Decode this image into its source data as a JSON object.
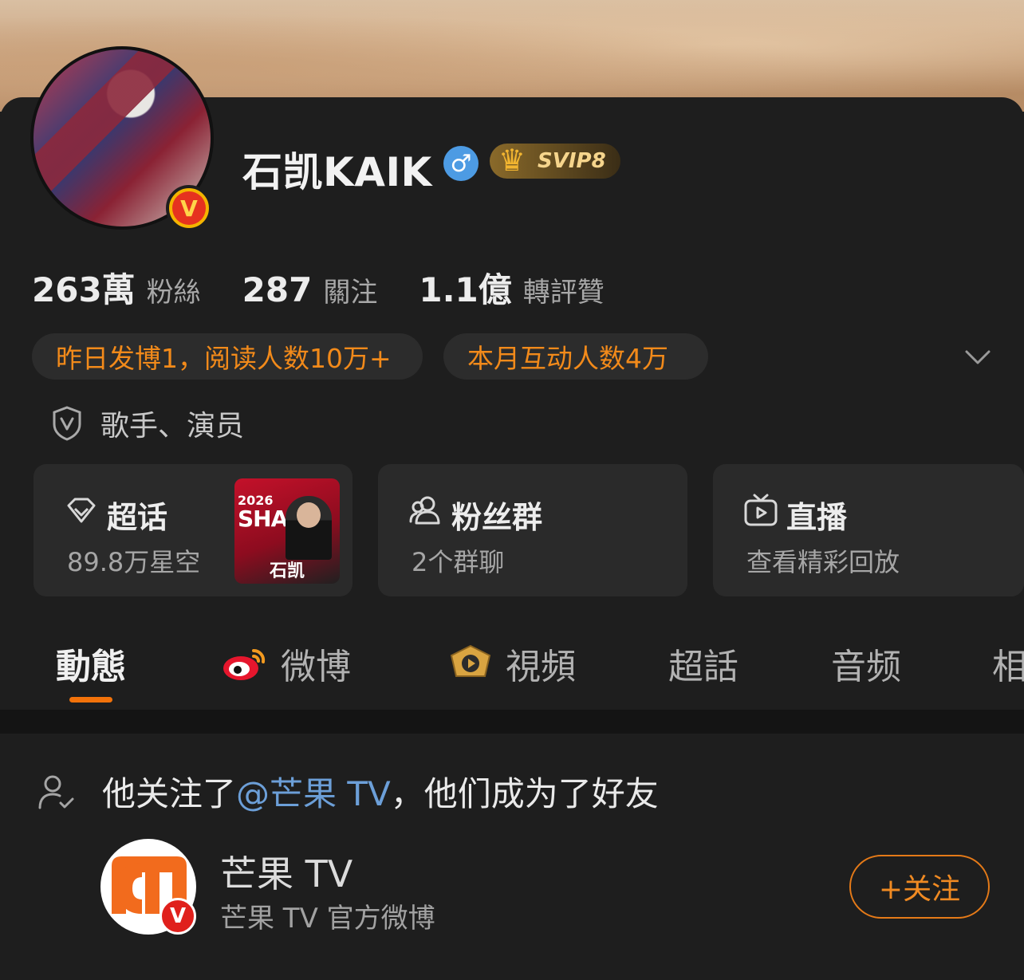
{
  "profile": {
    "name": "石凯KAIK",
    "gender_symbol": "♂",
    "vip_label": "SVIP8",
    "verified_symbol": "V"
  },
  "stats": [
    {
      "value": "263萬",
      "label": "粉絲"
    },
    {
      "value": "287",
      "label": "關注"
    },
    {
      "value": "1.1億",
      "label": "轉評贊"
    }
  ],
  "highlights": {
    "yesterday": "昨日发博1，阅读人数10万+",
    "month": "本月互动人数4万"
  },
  "tags": "歌手、演员",
  "features": [
    {
      "title": "超话",
      "sub": "89.8万星空",
      "icon": "diamond-icon"
    },
    {
      "title": "粉丝群",
      "sub": "2个群聊",
      "icon": "group-icon"
    },
    {
      "title": "直播",
      "sub": "查看精彩回放",
      "icon": "tv-icon"
    }
  ],
  "poster": {
    "year": "2026",
    "big": "SHAI",
    "name": "石凯"
  },
  "tabs": [
    {
      "label": "動態",
      "active": true
    },
    {
      "label": "微博"
    },
    {
      "label": "視頻"
    },
    {
      "label": "超話"
    },
    {
      "label": "音频"
    },
    {
      "label": "相"
    }
  ],
  "activity": {
    "prefix": "他关注了",
    "mention": "@芒果 TV",
    "suffix": "，他们成为了好友"
  },
  "suggested": {
    "name": "芒果 TV",
    "desc": "芒果 TV 官方微博",
    "follow_label": "+关注"
  },
  "colors": {
    "accent": "#f2720a",
    "mention": "#6c9fd8",
    "background": "#1e1e1e"
  }
}
